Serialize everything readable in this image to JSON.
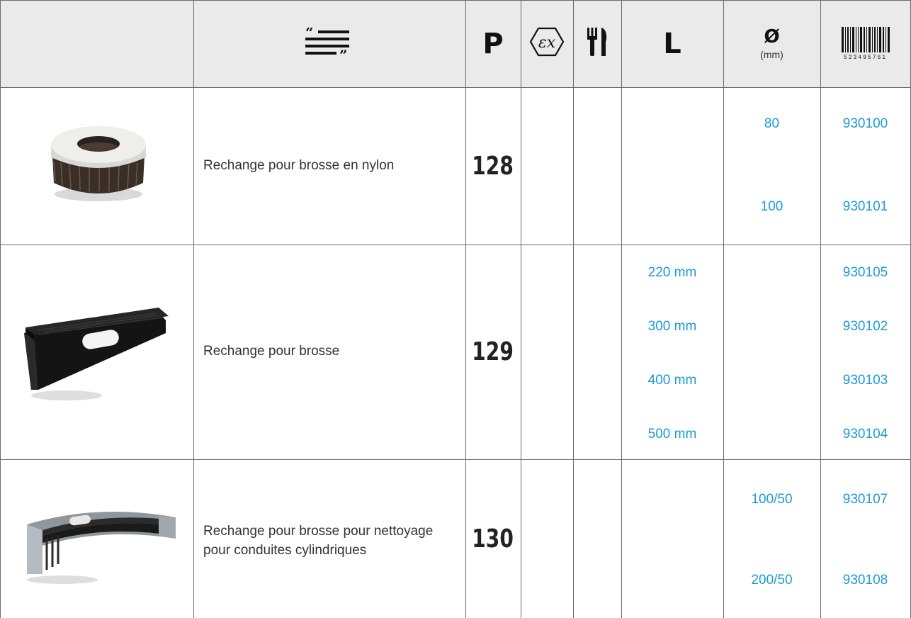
{
  "header": {
    "description_icon": "quote-lines-icon",
    "page_label": "P",
    "atex_icon": "ex-hexagon-icon",
    "food_icon": "fork-knife-icon",
    "length_label": "L",
    "diameter_symbol": "Ø",
    "diameter_unit": "(mm)",
    "barcode_icon": "barcode-icon",
    "barcode_digits": "523495761"
  },
  "rows": [
    {
      "image": "round-brush-refill-image",
      "description": "Rechange pour brosse en nylon",
      "page": "128",
      "lengths": [],
      "diameters": [
        "80",
        "100"
      ],
      "codes": [
        "930100",
        "930101"
      ]
    },
    {
      "image": "flat-brush-refill-image",
      "description": "Rechange pour brosse",
      "page": "129",
      "lengths": [
        "220 mm",
        "300 mm",
        "400 mm",
        "500 mm"
      ],
      "diameters": [],
      "codes": [
        "930105",
        "930102",
        "930103",
        "930104"
      ]
    },
    {
      "image": "curved-brush-refill-image",
      "description": "Rechange pour brosse pour nettoyage pour conduites cylindriques",
      "page": "130",
      "lengths": [],
      "diameters": [
        "100/50",
        "200/50"
      ],
      "codes": [
        "930107",
        "930108"
      ]
    }
  ],
  "colors": {
    "header_bg": "#eaeaea",
    "grid": "#6b6b6b",
    "value_blue": "#1b9ad6",
    "text": "#333333"
  }
}
